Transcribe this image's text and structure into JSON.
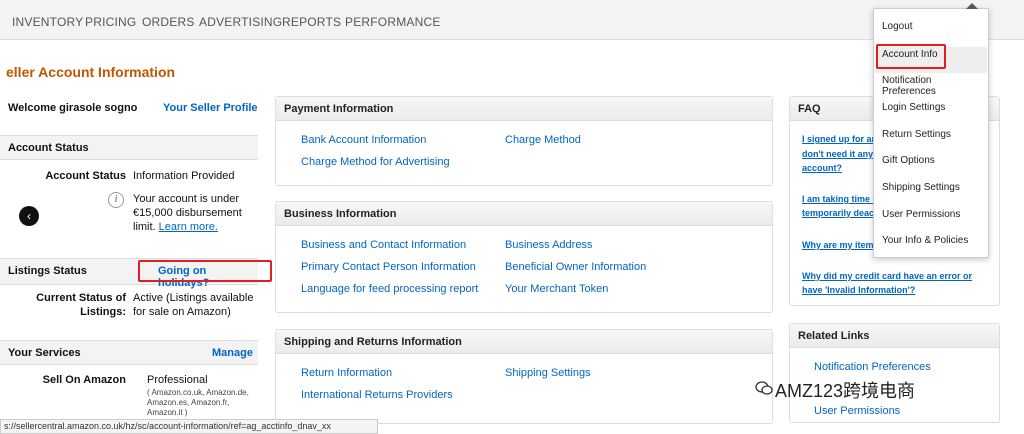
{
  "nav": {
    "items": [
      "INVENTORY",
      "PRICING",
      "ORDERS",
      "ADVERTISING",
      "REPORTS",
      "PERFORMANCE"
    ]
  },
  "page": {
    "title": "eller Account Information"
  },
  "welcome": {
    "text": "Welcome girasole sogno",
    "profile_link": "Your Seller Profile"
  },
  "account_status": {
    "title": "Account Status",
    "label": "Account Status",
    "value": "Information Provided",
    "note_prefix": "Your account is under €15,000 disbursement limit.",
    "note_link": "Learn more."
  },
  "listings_status": {
    "title": "Listings Status",
    "holiday_link": "Going on holidays?",
    "label": "Current Status of Listings:",
    "value": "Active (Listings available for sale on Amazon)"
  },
  "services": {
    "title": "Your Services",
    "manage": "Manage",
    "label": "Sell On Amazon",
    "value": "Professional",
    "markets": "( Amazon.co.uk, Amazon.de, Amazon.es, Amazon.fr, Amazon.it )"
  },
  "payment": {
    "title": "Payment Information",
    "links": [
      "Bank Account Information",
      "Charge Method",
      "Charge Method for Advertising"
    ]
  },
  "business": {
    "title": "Business Information",
    "links": [
      "Business and Contact Information",
      "Business Address",
      "Primary Contact Person Information",
      "Beneficial Owner Information",
      "Language for feed processing report",
      "Your Merchant Token"
    ]
  },
  "shipping": {
    "title": "Shipping and Returns Information",
    "links": [
      "Return Information",
      "Shipping Settings",
      "International Returns Providers"
    ]
  },
  "faq": {
    "title": "FAQ",
    "links": [
      "I signed up for ar",
      "don't need it anym",
      "account?",
      "I am taking time o",
      "temporarily deac",
      "Why are my items",
      "Why did my credit card have an error or",
      "have 'Invalid Information'?"
    ]
  },
  "related": {
    "title": "Related Links",
    "links": [
      "Notification Preferences",
      "User Permissions"
    ]
  },
  "dropdown": {
    "items": [
      "Logout",
      "Account Info",
      "Notification Preferences",
      "Login Settings",
      "Return Settings",
      "Gift Options",
      "Shipping Settings",
      "User Permissions",
      "Your Info & Policies"
    ]
  },
  "status_bar": {
    "url": "s://sellercentral.amazon.co.uk/hz/sc/account-information/ref=ag_acctinfo_dnav_xx"
  },
  "watermark": {
    "text": "AMZ123跨境电商"
  },
  "colors": {
    "accent": "#c45500",
    "link": "#0066c0",
    "highlight_box": "#e02020"
  }
}
